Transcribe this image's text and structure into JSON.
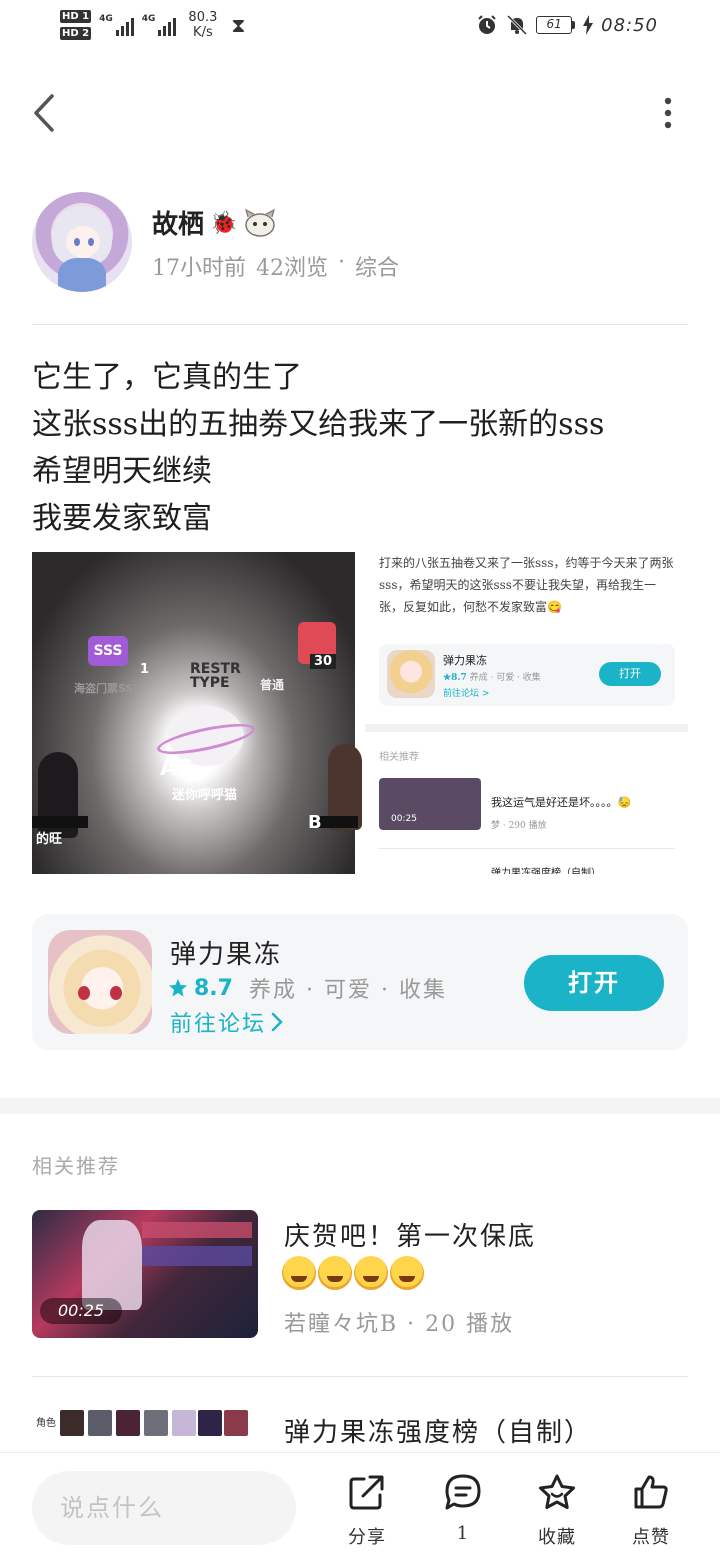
{
  "status_bar": {
    "hd1": "HD 1",
    "hd2": "HD 2",
    "net1": "4G",
    "net2": "4G",
    "speed_value": "80.3",
    "speed_unit": "K/s",
    "battery": "61",
    "time": "08:50",
    "icons": [
      "hourglass-icon",
      "alarm-icon",
      "mute-icon",
      "battery-icon",
      "charging-icon"
    ]
  },
  "nav": {
    "back_icon": "chevron-left-icon",
    "more_icon": "more-vertical-icon"
  },
  "author": {
    "name": "故栖",
    "name_deco": "🐞",
    "time_ago": "17小时前",
    "views": "42浏览",
    "separator": "·",
    "category": "综合"
  },
  "post": {
    "lines": [
      "它生了，它真的生了",
      "这张sss出的五抽劵又给我来了一张新的sss",
      "希望明天继续",
      "我要发家致富"
    ]
  },
  "post_image": {
    "game": {
      "sss_badge": "SSS",
      "sss_count": "1",
      "sss_name": "海盗门票SSS",
      "red_count": "30",
      "restr_label": "RESTR TYPE",
      "normal_label": "普通",
      "ab_label": "AB",
      "center_name": "迷你呼呼猫",
      "left_name": "的旺",
      "right_label": "B"
    },
    "screenshot": {
      "text": "打来的八张五抽卷又来了一张sss，约等于今天来了两张sss，希望明天的这张sss不要让我失望，再给我生一张，反复如此，何愁不发家致富😋",
      "app_name": "弹力果冻",
      "app_rating": "★8.7",
      "app_tags": "养成 · 可爱 · 收集",
      "app_forum": "前往论坛 >",
      "app_open": "打开",
      "related_label": "相关推荐",
      "video_duration": "00:25",
      "video_title": "我这运气是好还是坏。。。。😓",
      "video_meta": "梦 · 290 播放",
      "next_title": "弹力果冻强度榜（自制）"
    }
  },
  "app_card": {
    "name": "弹力果冻",
    "star_icon": "star-icon",
    "rating": "8.7",
    "tags": "养成 · 可爱 · 收集",
    "forum_link": "前往论坛",
    "forum_arrow": "›",
    "open_button": "打开",
    "accent_color": "#1ab3c8"
  },
  "related": {
    "title": "相关推荐",
    "items": [
      {
        "title": "庆贺吧！第一次保底",
        "emoji_count": 4,
        "duration": "00:25",
        "meta": "若瞳々坑B · 20 播放"
      },
      {
        "title": "弹力果冻强度榜（自制）",
        "thumb_label": "角色"
      }
    ]
  },
  "bottom_bar": {
    "comment_placeholder": "说点什么",
    "share_label": "分享",
    "comment_count": "1",
    "favorite_label": "收藏",
    "like_label": "点赞"
  }
}
